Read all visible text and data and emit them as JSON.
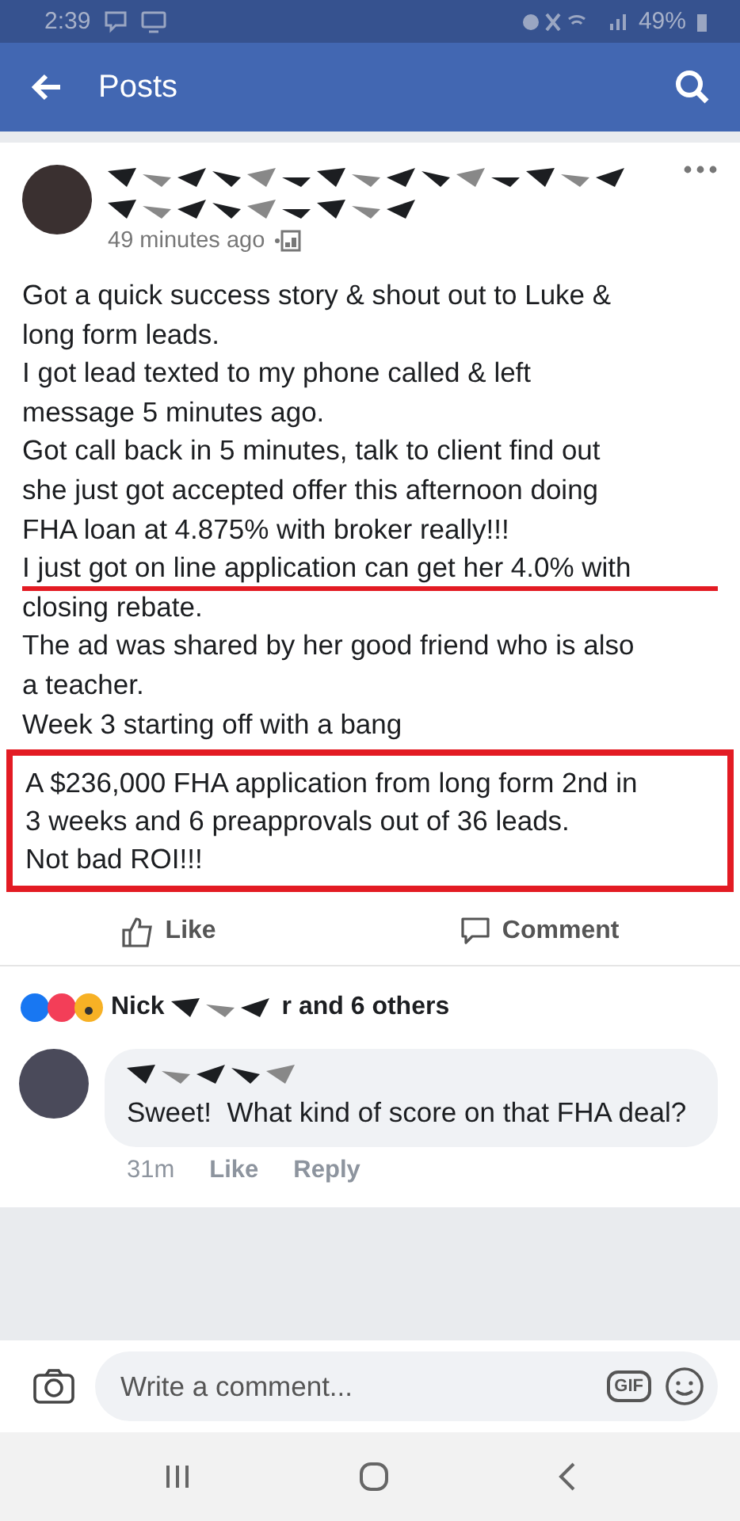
{
  "status_bar": {
    "time": "2:39",
    "battery": "49%"
  },
  "app_bar": {
    "title": "Posts"
  },
  "post": {
    "timestamp": "49 minutes ago",
    "lines": [
      {
        "text": "Got a quick success story & shout out to Luke &",
        "underlined": false
      },
      {
        "text": "long form leads.",
        "underlined": false
      },
      {
        "text": "I got lead texted to my phone called & left",
        "underlined": false
      },
      {
        "text": "message 5 minutes ago.",
        "underlined": false
      },
      {
        "text": "Got call back in 5 minutes, talk to client find out",
        "underlined": false
      },
      {
        "text": "she just got accepted offer this afternoon doing",
        "underlined": false
      },
      {
        "text": "FHA loan at 4.875% with broker really!!!",
        "underlined": false
      },
      {
        "text": "I just got on line application can get her 4.0% with",
        "underlined": true
      },
      {
        "text": "closing rebate.",
        "underlined": false
      },
      {
        "text": "The ad was shared by her good friend who is also",
        "underlined": false
      },
      {
        "text": "a teacher.",
        "underlined": false
      },
      {
        "text": "Week 3 starting off with a bang",
        "underlined": false
      }
    ],
    "boxed_lines": [
      "A $236,000 FHA application from long form 2nd in",
      "3 weeks and 6 preapprovals out of 36 leads.",
      "Not bad ROI!!!"
    ],
    "actions": [
      "Like",
      "Comment"
    ]
  },
  "reactions": {
    "name_start": "Nick",
    "name_end": "r and 6 others"
  },
  "comment": {
    "text": "Sweet!  What kind of score on that FHA deal?",
    "time": "31m",
    "actions": [
      "Like",
      "Reply"
    ]
  },
  "composer": {
    "placeholder": "Write a comment...",
    "gif": "GIF"
  }
}
